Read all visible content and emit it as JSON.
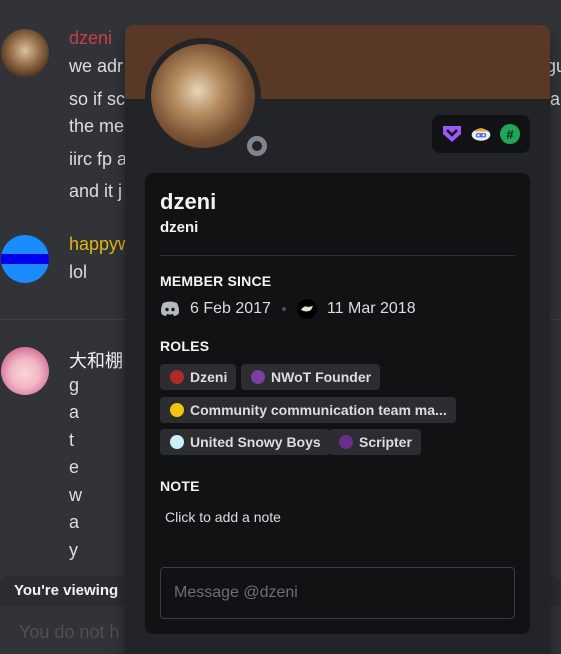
{
  "chat": {
    "messages": [
      {
        "author": "dzeni",
        "author_color": "#c64047",
        "lines": [
          "we adr",
          "so if sc",
          "the me",
          "iirc fp a",
          "and it j"
        ],
        "right_fragments": [
          "gu",
          "a"
        ]
      },
      {
        "author": "happyw",
        "author_color": "#e2b616",
        "lines": [
          "lol"
        ]
      },
      {
        "author": "大和棚",
        "author_color": "#f2f3f5",
        "lines": [
          "g",
          "a",
          "t",
          "e",
          "w",
          "a",
          "y"
        ]
      }
    ],
    "viewing_banner": "You're viewing",
    "input_placeholder": "You do not h"
  },
  "popout": {
    "banner_color": "#593826",
    "status": "offline",
    "badges": [
      {
        "icon": "hypesquad-balance-icon"
      },
      {
        "icon": "clyde-badge-icon"
      },
      {
        "icon": "hash-badge-icon",
        "glyph": "#"
      }
    ],
    "display_name": "dzeni",
    "username": "dzeni",
    "member_since": {
      "title": "MEMBER SINCE",
      "discord_date": "6 Feb 2017",
      "server_date": "11 Mar 2018"
    },
    "roles": {
      "title": "ROLES",
      "items": [
        {
          "name": "Dzeni",
          "color": "#b02a2a"
        },
        {
          "name": "NWoT Founder",
          "color": "#7b3fa0"
        },
        {
          "name": "Community communication team ma...",
          "color": "#f1c40f"
        },
        {
          "name": "United Snowy Boys",
          "color": "#cdeffc"
        },
        {
          "name": "Scripter",
          "color": "#6a2e8a"
        }
      ]
    },
    "note": {
      "title": "NOTE",
      "placeholder": "Click to add a note"
    },
    "message_input": {
      "placeholder": "Message @dzeni"
    }
  }
}
